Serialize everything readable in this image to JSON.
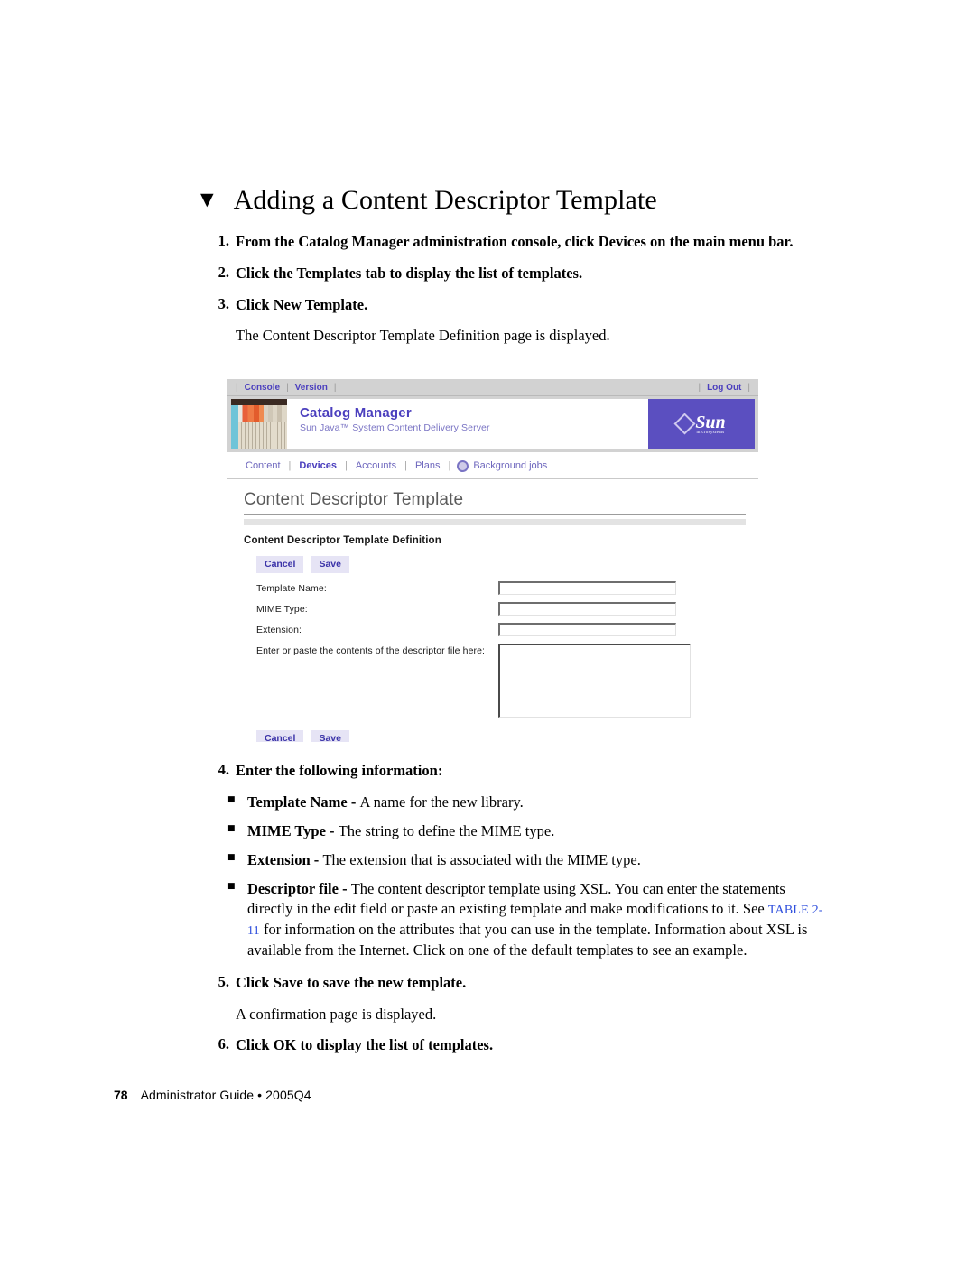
{
  "heading": {
    "marker": "▼",
    "title": "Adding a Content Descriptor Template"
  },
  "steps": [
    {
      "num": "1.",
      "text": "From the Catalog Manager administration console, click Devices on the main menu bar."
    },
    {
      "num": "2.",
      "text": "Click the Templates tab to display the list of templates."
    },
    {
      "num": "3.",
      "text": "Click New Template.",
      "followup": "The Content Descriptor Template Definition page is displayed."
    },
    {
      "num": "4.",
      "text": "Enter the following information:"
    },
    {
      "num": "5.",
      "text": "Click Save to save the new template.",
      "followup": "A confirmation page is displayed."
    },
    {
      "num": "6.",
      "text": "Click OK to display the list of templates."
    }
  ],
  "bullets": [
    {
      "mark": "■",
      "term": "Template Name - ",
      "rest": "A name for the new library."
    },
    {
      "mark": "■",
      "term": "MIME Type - ",
      "rest": "The string to define the MIME type."
    },
    {
      "mark": "■",
      "term": "Extension - ",
      "rest": "The extension that is associated with the MIME type."
    },
    {
      "mark": "■",
      "term": "Descriptor file - ",
      "rest_before": "The content descriptor template using XSL. You can enter the statements directly in the edit field or paste an existing template and make modifications to it. See ",
      "xref": "TABLE 2-11",
      "rest_after": " for information on the attributes that you can use in the template. Information about XSL is available from the Internet. Click on one of the default templates to see an example."
    }
  ],
  "screenshot": {
    "topbar": {
      "console": "Console",
      "version": "Version",
      "logout": "Log Out",
      "separator": "|"
    },
    "banner": {
      "title": "Catalog Manager",
      "subtitle": "Sun Java™ System Content Delivery Server",
      "logo_word": "Sun",
      "logo_sub": "microsystems"
    },
    "nav": {
      "items": [
        {
          "label": "Content",
          "active": false
        },
        {
          "label": "Devices",
          "active": true
        },
        {
          "label": "Accounts",
          "active": false
        },
        {
          "label": "Plans",
          "active": false
        },
        {
          "label": "Background jobs",
          "active": false,
          "icon": "background-jobs-icon"
        }
      ],
      "separator": "|"
    },
    "page_title": "Content Descriptor Template",
    "form_title": "Content Descriptor Template Definition",
    "buttons": {
      "cancel": "Cancel",
      "save": "Save"
    },
    "fields": [
      {
        "label": "Template Name:",
        "value": ""
      },
      {
        "label": "MIME Type:",
        "value": ""
      },
      {
        "label": "Extension:",
        "value": ""
      }
    ],
    "textarea": {
      "label": "Enter or paste the contents of the descriptor file here:",
      "value": ""
    }
  },
  "footer": {
    "page_number": "78",
    "text": "Administrator Guide • 2005Q4"
  },
  "colors": {
    "brand_purple": "#4b3fbe",
    "logo_bg": "#5b4fc0",
    "xref_blue": "#2f4fdd",
    "chrome_gray": "#d2d2d2"
  }
}
